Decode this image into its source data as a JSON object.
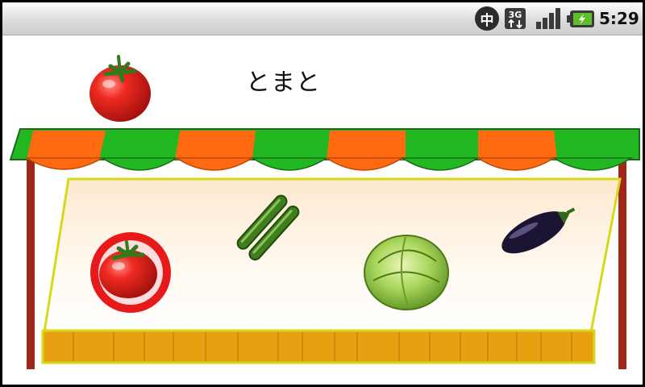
{
  "status_bar": {
    "ime_label": "中",
    "network_label": "3G",
    "time": "5:29",
    "icons": [
      "ime-indicator-icon",
      "network-3g-icon",
      "signal-strength-icon",
      "battery-charging-icon"
    ]
  },
  "prompt": {
    "word": "とまと",
    "target_icon": "tomato-icon"
  },
  "shelf": {
    "items": [
      {
        "name": "tomato",
        "icon": "tomato-icon",
        "selected": true
      },
      {
        "name": "cucumber",
        "icon": "cucumber-icon",
        "selected": false
      },
      {
        "name": "cabbage",
        "icon": "cabbage-icon",
        "selected": false
      },
      {
        "name": "eggplant",
        "icon": "eggplant-icon",
        "selected": false
      }
    ]
  },
  "colors": {
    "awning_green": "#22b822",
    "awning_orange": "#ff6a10",
    "pole": "#a0261a",
    "counter_border": "#d8d81a",
    "counter_front": "#e8a010",
    "highlight_ring": "#e8191a"
  }
}
